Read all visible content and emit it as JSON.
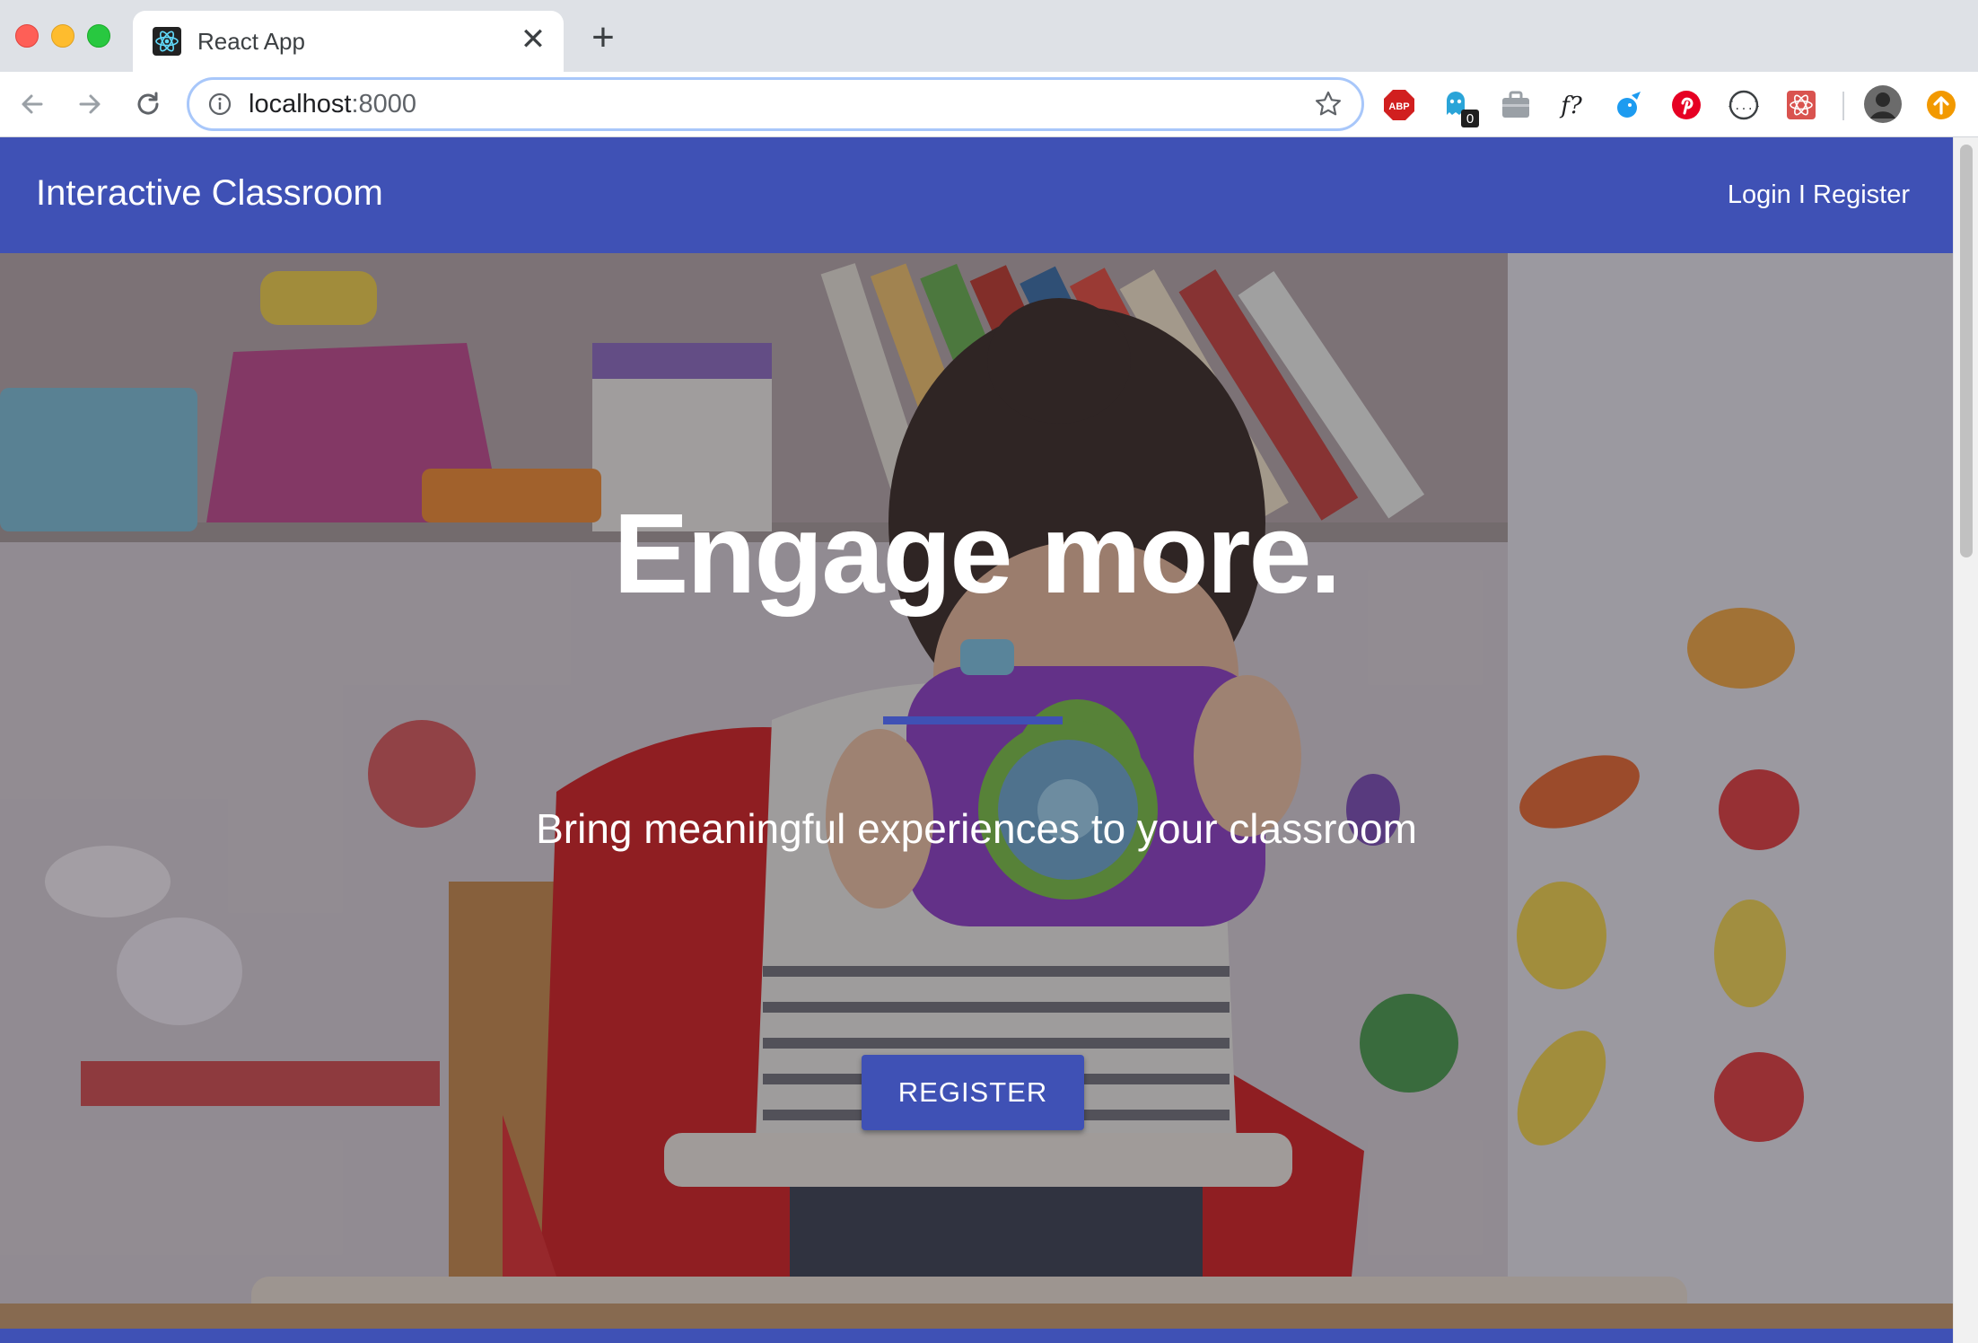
{
  "browser": {
    "tab_title": "React App",
    "tab_close": "✕",
    "new_tab": "+",
    "url_host": "localhost",
    "url_port": ":8000",
    "extensions": [
      "adblock-plus-icon",
      "ghostery-icon",
      "briefcase-icon",
      "whatfont-icon",
      "bird-icon",
      "pinterest-icon",
      "json-viewer-icon",
      "react-devtools-icon",
      "profile-avatar",
      "update-icon"
    ],
    "extension_labels": {
      "abp": "ABP",
      "ghostery_count": "0",
      "whatfont": "f?"
    }
  },
  "app": {
    "title": "Interactive Classroom",
    "login": "Login",
    "separator": "I",
    "register_link": "Register",
    "accent": "#3f51b5"
  },
  "hero": {
    "heading": "Engage more.",
    "subheading": "Bring meaningful experiences to your classroom",
    "cta": "REGISTER"
  }
}
